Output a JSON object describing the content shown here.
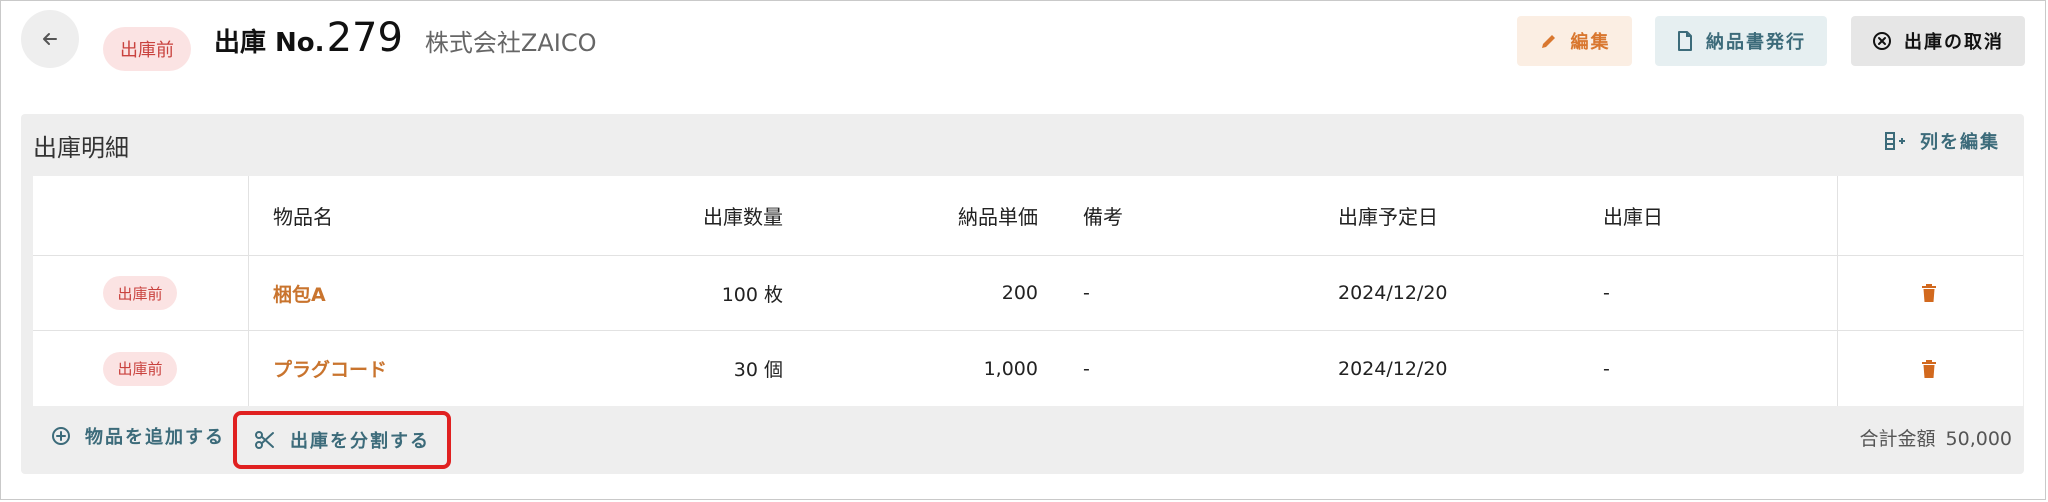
{
  "header": {
    "status": "出庫前",
    "label": "出庫 No.",
    "number": "279",
    "company": "株式会社ZAICO",
    "edit_label": "編集",
    "invoice_label": "納品書発行",
    "cancel_label": "出庫の取消"
  },
  "section": {
    "title": "出庫明細",
    "edit_columns_label": "列を編集",
    "columns": [
      "物品名",
      "出庫数量",
      "納品単価",
      "備考",
      "出庫予定日",
      "出庫日"
    ],
    "rows": [
      {
        "status": "出庫前",
        "name": "梱包A",
        "quantity": "100 枚",
        "unit_price": "200",
        "note": "-",
        "planned_date": "2024/12/20",
        "ship_date": "-"
      },
      {
        "status": "出庫前",
        "name": "プラグコード",
        "quantity": "30 個",
        "unit_price": "1,000",
        "note": "-",
        "planned_date": "2024/12/20",
        "ship_date": "-"
      }
    ]
  },
  "footer": {
    "add_label": "物品を追加する",
    "split_label": "出庫を分割する",
    "total_label": "合計金額",
    "total_value": "50,000"
  },
  "colors": {
    "accent_orange": "#c9742e",
    "teal": "#3c6b7a",
    "status_red": "#c9423e",
    "highlight_red": "#e02020"
  }
}
